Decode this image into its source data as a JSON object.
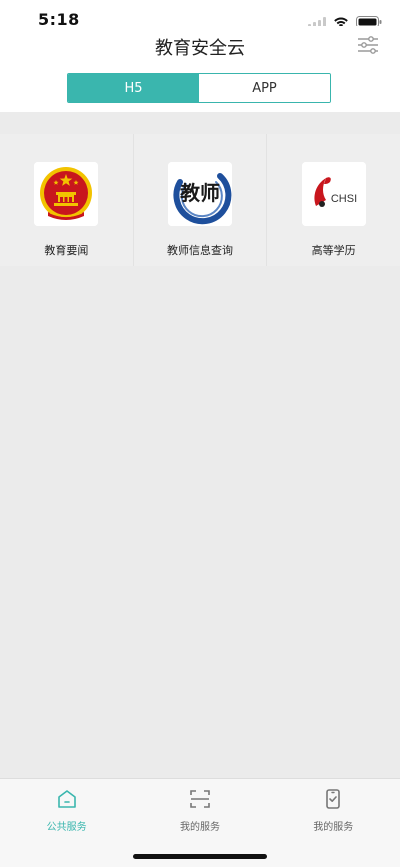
{
  "status_bar": {
    "time": "5:18",
    "icons": [
      "cellular-signal-icon",
      "wifi-icon",
      "battery-icon"
    ]
  },
  "header": {
    "title": "教育安全云",
    "filter_icon": "filter-sliders-icon",
    "segments": [
      {
        "label": "H5",
        "active": true
      },
      {
        "label": "APP",
        "active": false
      }
    ]
  },
  "services": [
    {
      "label": "教育要闻",
      "icon": "national-emblem-icon"
    },
    {
      "label": "教师信息查询",
      "icon": "teacher-calligraphy-logo",
      "logo_text": "教师"
    },
    {
      "label": "高等学历",
      "icon": "chsi-logo",
      "logo_text": "CHSI"
    }
  ],
  "tab_bar": {
    "tabs": [
      {
        "label": "公共服务",
        "icon": "home-icon",
        "active": true
      },
      {
        "label": "我的服务",
        "icon": "scan-icon",
        "active": false
      },
      {
        "label": "我的服务",
        "icon": "phone-check-icon",
        "active": false
      }
    ]
  },
  "colors": {
    "accent": "#3ab6ae",
    "background": "#ebebeb",
    "surface": "#ffffff",
    "emblem_red": "#c8161d",
    "emblem_gold": "#f2c300",
    "teacher_blue": "#1e4f9c"
  }
}
